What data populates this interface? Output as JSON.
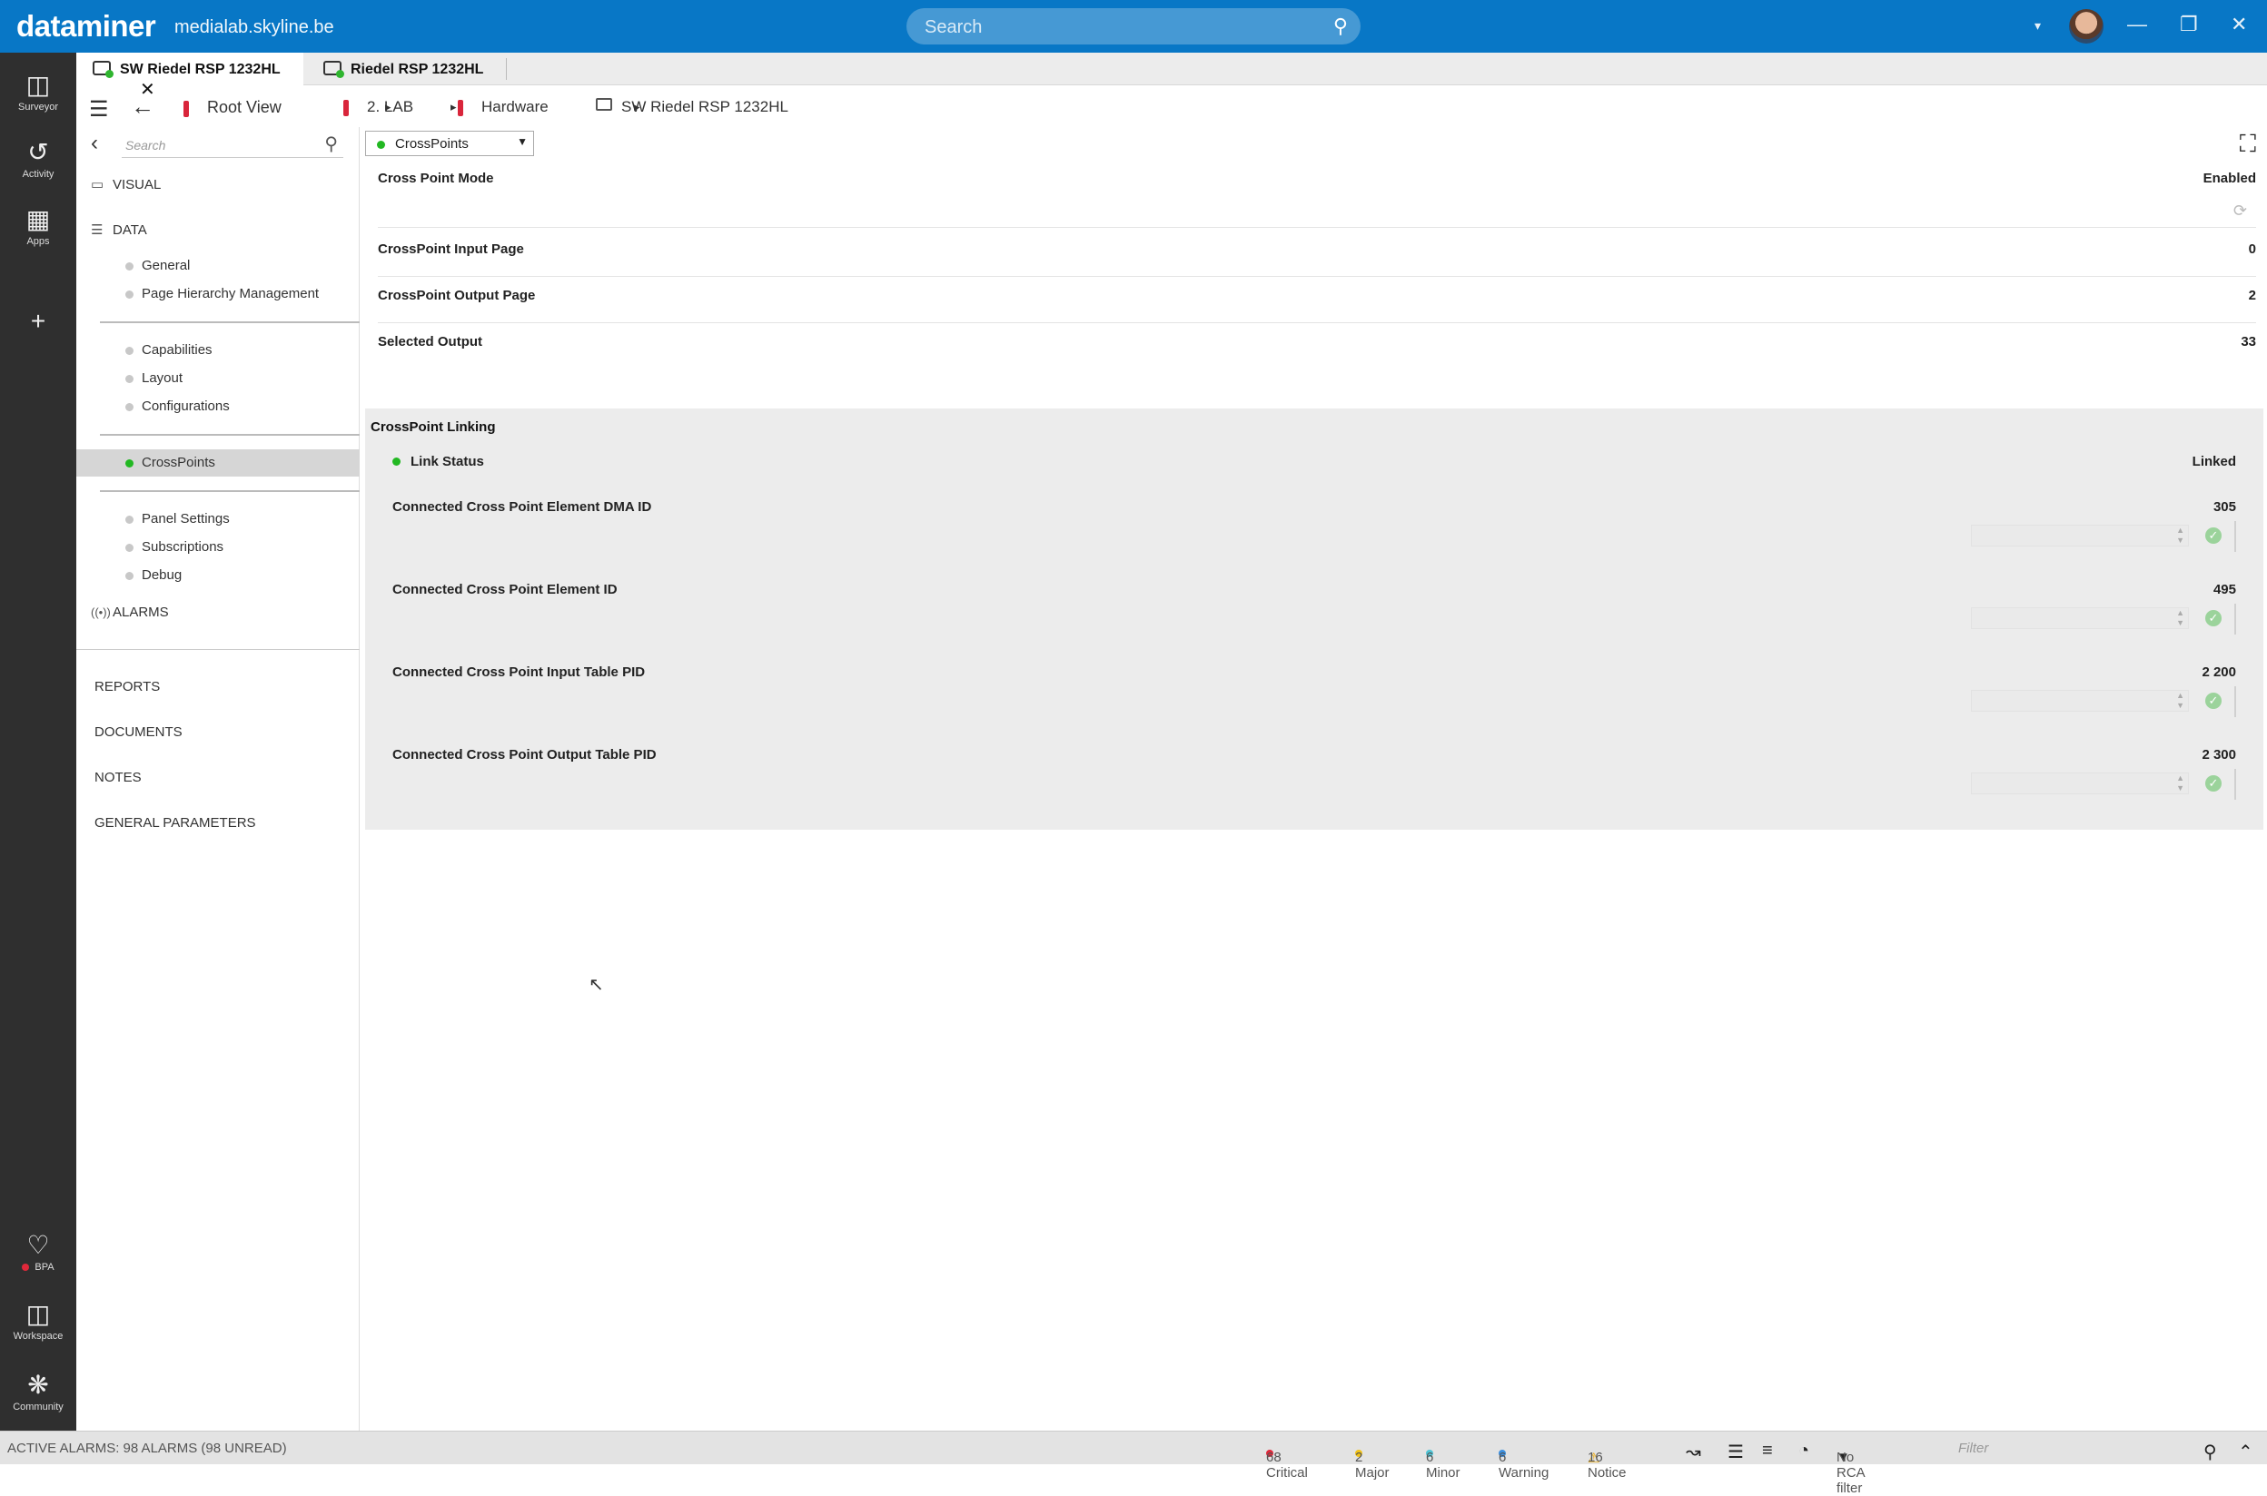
{
  "app": {
    "logo": "dataminer",
    "host": "medialab.skyline.be",
    "search_placeholder": "Search"
  },
  "rail": {
    "surveyor": "Surveyor",
    "activity": "Activity",
    "apps": "Apps",
    "bpa": "BPA",
    "workspace": "Workspace",
    "community": "Community"
  },
  "tabs": [
    {
      "label": "SW Riedel RSP 1232HL"
    },
    {
      "label": "Riedel RSP 1232HL"
    }
  ],
  "breadcrumb": [
    "Root View",
    "2. LAB",
    "Hardware",
    "SW Riedel RSP 1232HL"
  ],
  "nav": {
    "search_placeholder": "Search",
    "visual": "VISUAL",
    "data": "DATA",
    "items_group1": [
      "General",
      "Page Hierarchy Management"
    ],
    "items_group2": [
      "Capabilities",
      "Layout",
      "Configurations"
    ],
    "items_group3": [
      "CrossPoints"
    ],
    "items_group4": [
      "Panel Settings",
      "Subscriptions",
      "Debug"
    ],
    "alarms": "ALARMS",
    "sections": [
      "REPORTS",
      "DOCUMENTS",
      "NOTES",
      "GENERAL PARAMETERS"
    ]
  },
  "main": {
    "page_select": "CrossPoints",
    "params": [
      {
        "label": "Cross Point Mode",
        "value": "Enabled"
      },
      {
        "label": "CrossPoint Input Page",
        "value": "0"
      },
      {
        "label": "CrossPoint Output Page",
        "value": "2"
      },
      {
        "label": "Selected Output",
        "value": "33"
      }
    ],
    "linking": {
      "title": "CrossPoint Linking",
      "status_label": "Link Status",
      "status_value": "Linked",
      "rows": [
        {
          "label": "Connected Cross Point Element DMA ID",
          "value": "305"
        },
        {
          "label": "Connected Cross Point Element ID",
          "value": "495"
        },
        {
          "label": "Connected Cross Point Input Table PID",
          "value": "2 200"
        },
        {
          "label": "Connected Cross Point Output Table PID",
          "value": "2 300"
        }
      ]
    }
  },
  "status": {
    "active_alarms": "ACTIVE ALARMS: 98 ALARMS (98 UNREAD)",
    "critical": "68 Critical",
    "major": "2 Major",
    "minor": "6 Minor",
    "warning": "6 Warning",
    "notice": "16 Notice",
    "rca": "No RCA filter",
    "filter_placeholder": "Filter"
  },
  "colors": {
    "brand": "#0877c6",
    "critical": "#e0283a",
    "major": "#f2c318",
    "minor": "#4ec4d6",
    "warning": "#3b8fe0",
    "notice": "#f0a800",
    "ok": "#22b822"
  }
}
